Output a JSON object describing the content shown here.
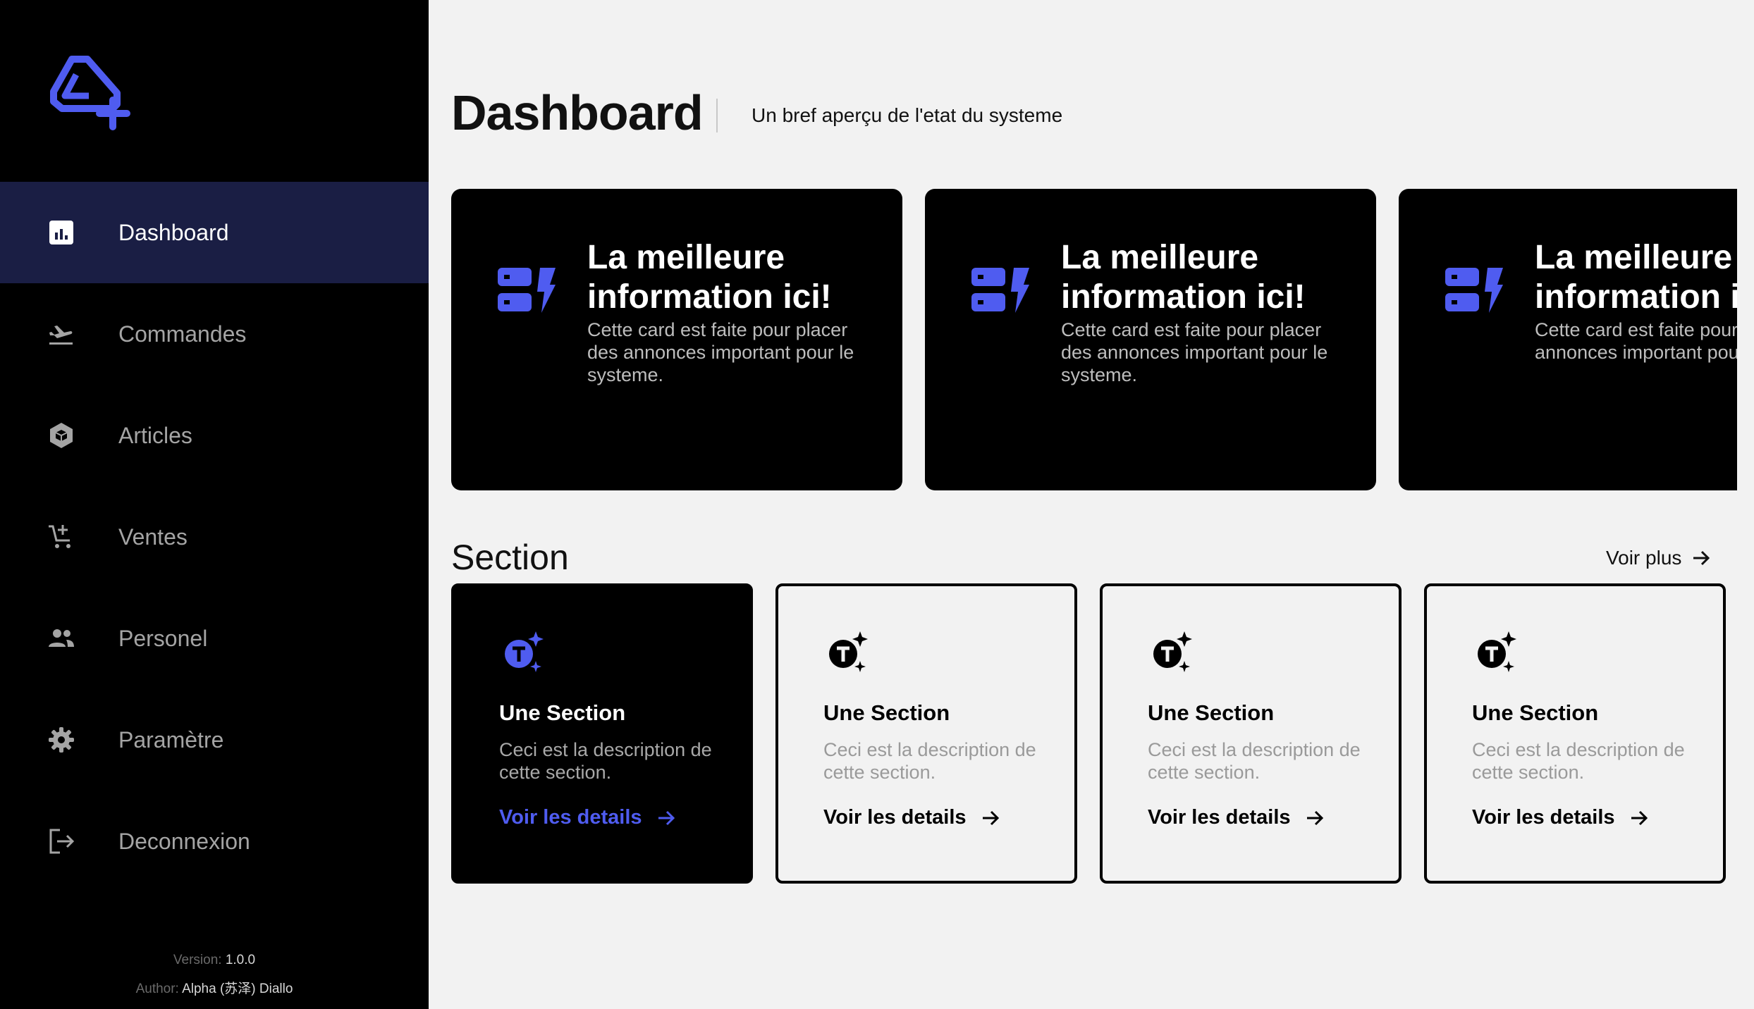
{
  "colors": {
    "accent": "#4f5cf0",
    "sidebar_bg": "#000000",
    "active_nav_bg": "#1a1e44",
    "main_bg": "#f2f2f2"
  },
  "sidebar": {
    "logo_icon": "a-plus-logo-icon",
    "items": [
      {
        "label": "Dashboard",
        "icon": "bar-chart-icon",
        "active": true
      },
      {
        "label": "Commandes",
        "icon": "plane-takeoff-icon",
        "active": false
      },
      {
        "label": "Articles",
        "icon": "cube-icon",
        "active": false
      },
      {
        "label": "Ventes",
        "icon": "cart-add-icon",
        "active": false
      },
      {
        "label": "Personel",
        "icon": "people-icon",
        "active": false
      },
      {
        "label": "Paramètre",
        "icon": "gear-icon",
        "active": false
      },
      {
        "label": "Deconnexion",
        "icon": "logout-icon",
        "active": false
      }
    ],
    "footer": {
      "version_label": "Version:",
      "version_value": "1.0.0",
      "author_label": "Author:",
      "author_value": "Alpha (苏泽) Diallo"
    }
  },
  "header": {
    "title": "Dashboard",
    "subtitle": "Un bref aperçu de l'etat du systeme"
  },
  "promo_cards": [
    {
      "title_line1": "La meilleure",
      "title_line2": "information ici!",
      "description": "Cette card est faite pour placer des annonces important pour le systeme.",
      "icon": "server-bolt-icon"
    },
    {
      "title_line1": "La meilleure",
      "title_line2": "information ici!",
      "description": "Cette card est faite pour placer des annonces important pour le systeme.",
      "icon": "server-bolt-icon"
    },
    {
      "title_line1": "La meilleure",
      "title_line2": "information ici!",
      "description": "Cette card est faite pour placer des annonces important pour le systeme.",
      "icon": "server-bolt-icon"
    }
  ],
  "section": {
    "title": "Section",
    "see_more": "Voir plus",
    "cards": [
      {
        "title": "Une Section",
        "description": "Ceci est la description de cette section.",
        "link": "Voir les details",
        "icon": "token-sparkle-icon",
        "highlighted": true
      },
      {
        "title": "Une Section",
        "description": "Ceci est la description de cette section.",
        "link": "Voir les details",
        "icon": "token-sparkle-icon",
        "highlighted": false
      },
      {
        "title": "Une Section",
        "description": "Ceci est la description de cette section.",
        "link": "Voir les details",
        "icon": "token-sparkle-icon",
        "highlighted": false
      },
      {
        "title": "Une Section",
        "description": "Ceci est la description de cette section.",
        "link": "Voir les details",
        "icon": "token-sparkle-icon",
        "highlighted": false
      }
    ]
  }
}
